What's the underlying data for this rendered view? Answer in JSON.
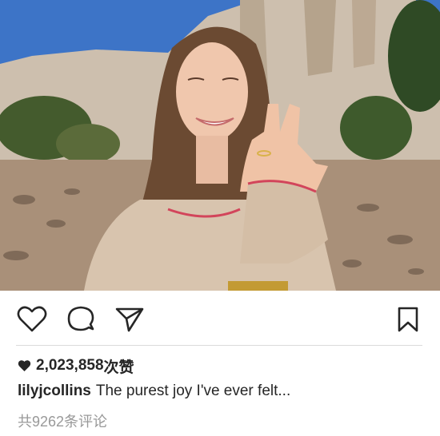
{
  "post": {
    "image": {
      "description_icon": "photo-icon",
      "colors": {
        "sky": "#3f77c9",
        "cliff": "#cdbfae",
        "sweater": "#d8c4ae",
        "hair": "#6b4a32"
      }
    },
    "actions": {
      "like_icon": "heart-outline-icon",
      "comment_icon": "comment-bubble-icon",
      "share_icon": "send-arrow-icon",
      "save_icon": "bookmark-icon"
    },
    "likes": {
      "icon": "heart-filled-icon",
      "count": "2,023,858",
      "unit": "次赞"
    },
    "caption": {
      "username": "lilyjcollins",
      "text": "The purest joy I've ever felt..."
    },
    "comments": {
      "summary": "共9262条评论"
    }
  }
}
